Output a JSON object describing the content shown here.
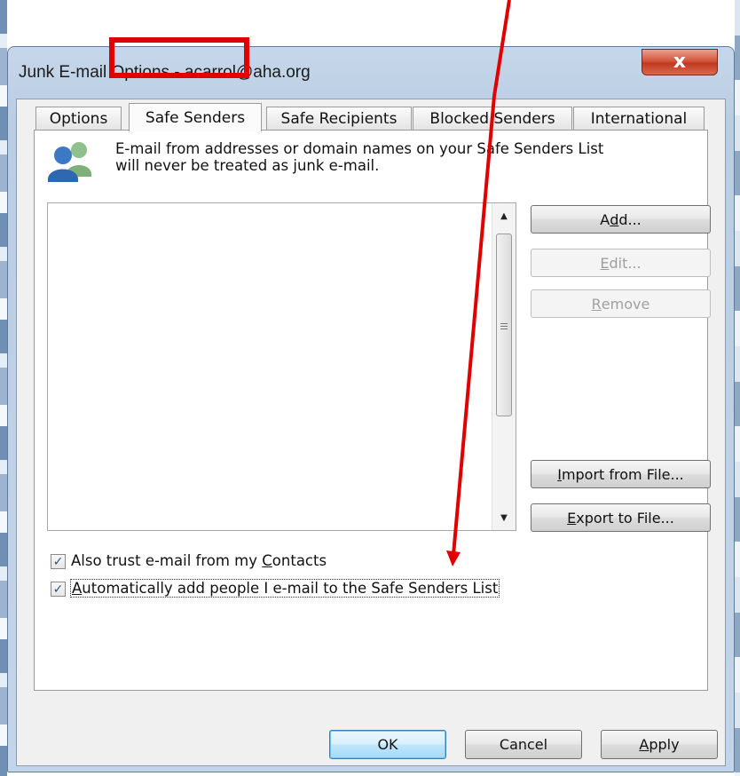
{
  "window": {
    "title": "Junk E-mail Options - acarrol@aha.org",
    "close_glyph": "x"
  },
  "tabs": [
    {
      "label": "Options"
    },
    {
      "label": "Safe Senders"
    },
    {
      "label": "Safe Recipients"
    },
    {
      "label": "Blocked Senders"
    },
    {
      "label": "International"
    }
  ],
  "active_tab": "Safe Senders",
  "info": {
    "icon": "people-icon",
    "line1": "E-mail from addresses or domain names on your Safe Senders List",
    "line2": "will never be treated as junk e-mail."
  },
  "side_buttons": {
    "add": {
      "pre": "A",
      "key": "d",
      "post": "d..."
    },
    "edit": {
      "pre": "",
      "key": "E",
      "post": "dit..."
    },
    "remove": {
      "pre": "",
      "key": "R",
      "post": "emove"
    },
    "import": {
      "pre": "",
      "key": "I",
      "post": "mport from File..."
    },
    "export": {
      "pre": "",
      "key": "E",
      "post": "xport to File..."
    }
  },
  "checkboxes": {
    "contacts": {
      "checked": true,
      "pre": "Also trust e-mail from my ",
      "key": "C",
      "post": "ontacts"
    },
    "auto_add": {
      "checked": true,
      "pre": "",
      "key": "A",
      "post": "utomatically add people I e-mail to the Safe Senders List"
    }
  },
  "footer": {
    "ok": "OK",
    "cancel": "Cancel",
    "apply_key": "A",
    "apply_post": "pply"
  },
  "colors": {
    "annotation_red": "#e00000",
    "window_frame": "#c3d5e8",
    "close_button": "#c0391f"
  }
}
